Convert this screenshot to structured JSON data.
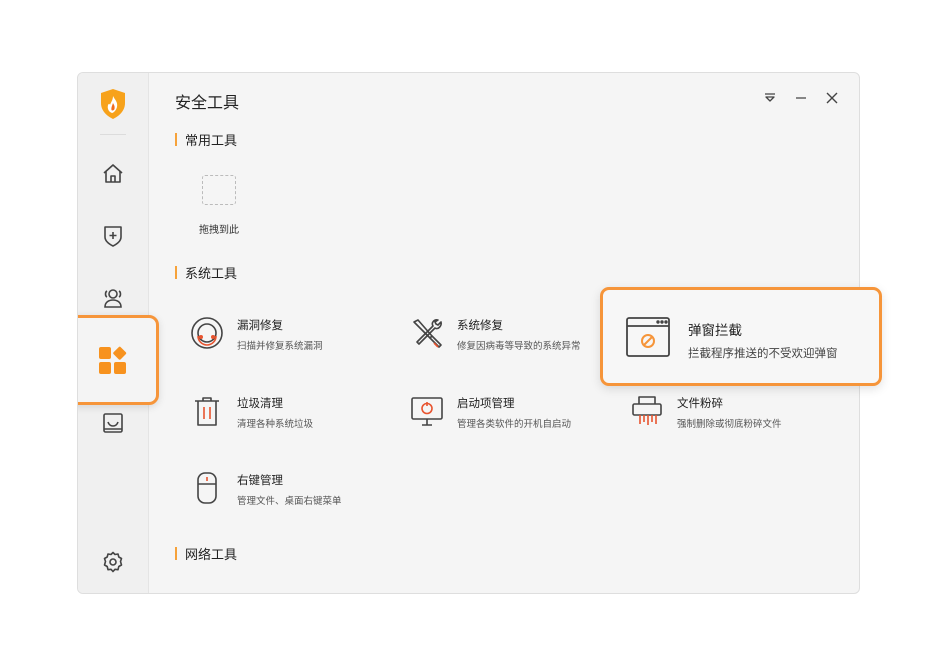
{
  "window": {
    "title": "安全工具",
    "controls": [
      "menu-icon",
      "minimize-icon",
      "close-icon"
    ]
  },
  "sidebar": {
    "items": [
      {
        "icon": "home-icon"
      },
      {
        "icon": "shield-plus-icon"
      },
      {
        "icon": "users-icon"
      },
      {
        "icon": "apps-icon",
        "active": true
      },
      {
        "icon": "inbox-icon"
      },
      {
        "icon": "gear-icon"
      }
    ]
  },
  "sections": {
    "common": "常用工具",
    "system": "系统工具",
    "network": "网络工具"
  },
  "drop_zone": {
    "label": "拖拽到此"
  },
  "tools": [
    {
      "name": "漏洞修复",
      "desc": "扫描并修复系统漏洞",
      "icon": "vulnerability-icon"
    },
    {
      "name": "系统修复",
      "desc": "修复因病毒等导致的系统异常",
      "icon": "repair-tools-icon"
    },
    {
      "name": "垃圾清理",
      "desc": "清理各种系统垃圾",
      "icon": "trash-icon"
    },
    {
      "name": "启动项管理",
      "desc": "管理各类软件的开机自启动",
      "icon": "startup-monitor-icon"
    },
    {
      "name": "文件粉碎",
      "desc": "强制删除或彻底粉碎文件",
      "icon": "shredder-icon"
    },
    {
      "name": "右键管理",
      "desc": "管理文件、桌面右键菜单",
      "icon": "mouse-icon"
    }
  ],
  "popup_block": {
    "name": "弹窗拦截",
    "desc": "拦截程序推送的不受欢迎弹窗",
    "icon": "popup-block-icon"
  },
  "colors": {
    "accent": "#f6953a",
    "section_bar": "#f6a23a",
    "icon_gray": "#444444",
    "vuln_red": "#e8542f"
  }
}
